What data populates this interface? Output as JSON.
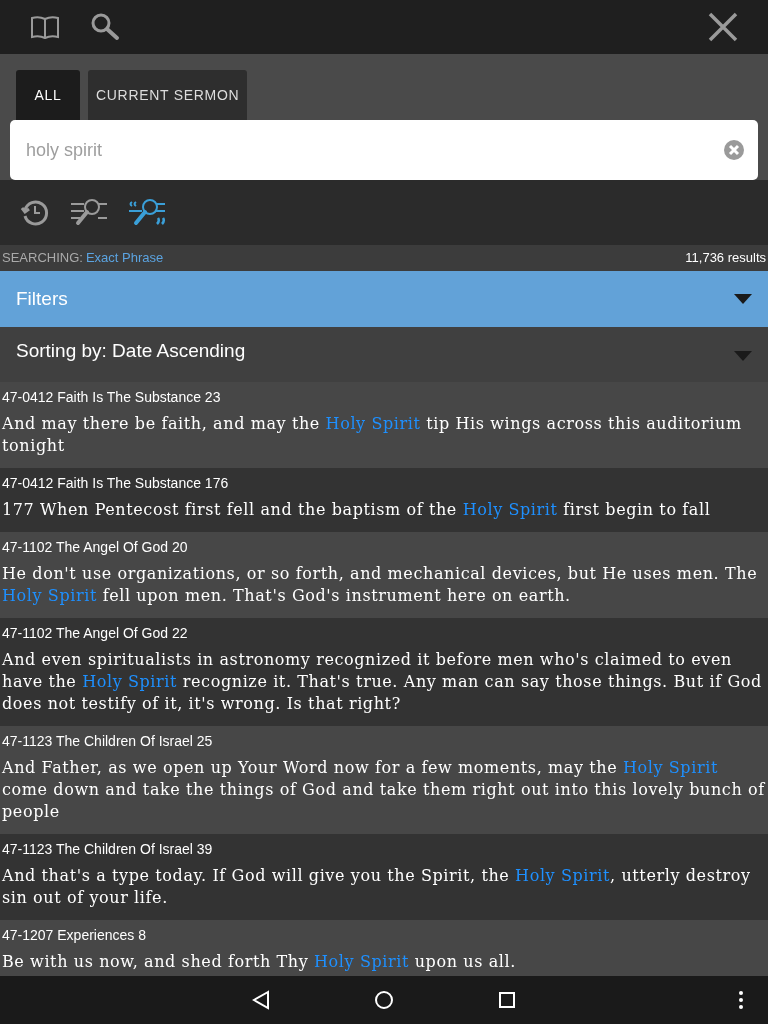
{
  "tabs": [
    {
      "label": "ALL",
      "selected": true
    },
    {
      "label": "CURRENT SERMON",
      "selected": false
    }
  ],
  "search": {
    "value": "holy spirit"
  },
  "search_modes": [
    {
      "kind": "history",
      "selected": false
    },
    {
      "kind": "words",
      "selected": false
    },
    {
      "kind": "phrase",
      "selected": true
    }
  ],
  "status": {
    "label": "SEARCHING:",
    "mode": "Exact Phrase",
    "count": "11,736 results"
  },
  "filters": {
    "label": "Filters",
    "expanded": false
  },
  "sorting": {
    "label": "Sorting by: Date Ascending"
  },
  "results": [
    {
      "reference": "47-0412 Faith Is The Substance 23",
      "before": "And may there be faith, and may the ",
      "match": "Holy Spirit",
      "after": " tip His wings across this auditorium tonight"
    },
    {
      "reference": "47-0412 Faith Is The Substance 176",
      "before": "177 When Pentecost first fell and the baptism of the ",
      "match": "Holy Spirit",
      "after": " first begin to fall"
    },
    {
      "reference": "47-1102 The Angel Of God 20",
      "before": "He don't use organizations, or so forth, and mechanical devices, but He uses men. The ",
      "match": "Holy Spirit",
      "after": " fell upon men. That's God's instrument here on earth."
    },
    {
      "reference": "47-1102 The Angel Of God 22",
      "before": "And even spiritualists in astronomy recognized it before men who's claimed to even have the ",
      "match": "Holy Spirit",
      "after": " recognize it. That's true. Any man can say those things. But if God does not testify of it, it's wrong. Is that right?"
    },
    {
      "reference": "47-1123 The Children Of Israel 25",
      "before": "And Father, as we open up Your Word now for a few moments, may the ",
      "match": "Holy Spirit",
      "after": " come down and take the things of God and take them right out into this lovely bunch of people"
    },
    {
      "reference": "47-1123 The Children Of Israel 39",
      "before": "And that's a type today. If God will give you the Spirit, the ",
      "match": "Holy Spirit",
      "after": ", utterly destroy sin out of your life."
    },
    {
      "reference": "47-1207 Experiences 8",
      "before": "Be with us now, and shed forth Thy ",
      "match": "Holy Spirit",
      "after": " upon us all."
    }
  ]
}
